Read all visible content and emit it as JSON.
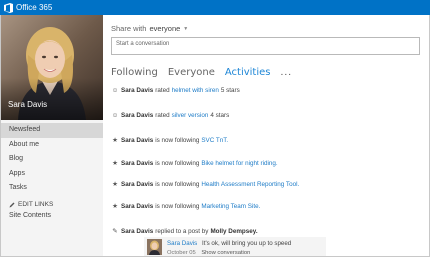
{
  "app": {
    "title": "Office 365",
    "accent": "#0072c6",
    "link_color": "#1e7cc7"
  },
  "profile": {
    "name": "Sara Davis"
  },
  "nav": {
    "items": [
      {
        "label": "Newsfeed",
        "active": true
      },
      {
        "label": "About me"
      },
      {
        "label": "Blog"
      },
      {
        "label": "Apps"
      },
      {
        "label": "Tasks"
      }
    ],
    "edit_links": "EDIT LINKS",
    "site_contents": "Site Contents"
  },
  "share": {
    "label": "Share with",
    "audience": "everyone",
    "placeholder": "Start a conversation"
  },
  "tabs": [
    {
      "label": "Following"
    },
    {
      "label": "Everyone"
    },
    {
      "label": "Activities",
      "active": true
    }
  ],
  "tabs_more": "...",
  "feed": [
    {
      "icon": "rating-icon",
      "actor": "Sara Davis",
      "verb": "rated",
      "link": "helmet with siren",
      "suffix": "5 stars"
    },
    {
      "icon": "rating-icon",
      "actor": "Sara Davis",
      "verb": "rated",
      "link": "silver version",
      "suffix": "4 stars"
    },
    {
      "icon": "star-icon",
      "actor": "Sara Davis",
      "verb": "is now following",
      "link": "SVC TnT.",
      "suffix": ""
    },
    {
      "icon": "star-icon",
      "actor": "Sara Davis",
      "verb": "is now following",
      "link": "Bike helmet for night riding.",
      "suffix": ""
    },
    {
      "icon": "star-icon",
      "actor": "Sara Davis",
      "verb": "is now following",
      "link": "Health Assessment Reporting Tool.",
      "suffix": ""
    },
    {
      "icon": "star-icon",
      "actor": "Sara Davis",
      "verb": "is now following",
      "link": "Marketing Team Site.",
      "suffix": ""
    },
    {
      "icon": "pencil-icon",
      "actor": "Sara Davis",
      "verb": "replied to a post by",
      "link": "Molly Dempsey.",
      "suffix": ""
    }
  ],
  "reply": {
    "actor": "Sara Davis",
    "text": "It's ok, will bring you up to speed",
    "date": "October 05",
    "action": "Show conversation"
  }
}
